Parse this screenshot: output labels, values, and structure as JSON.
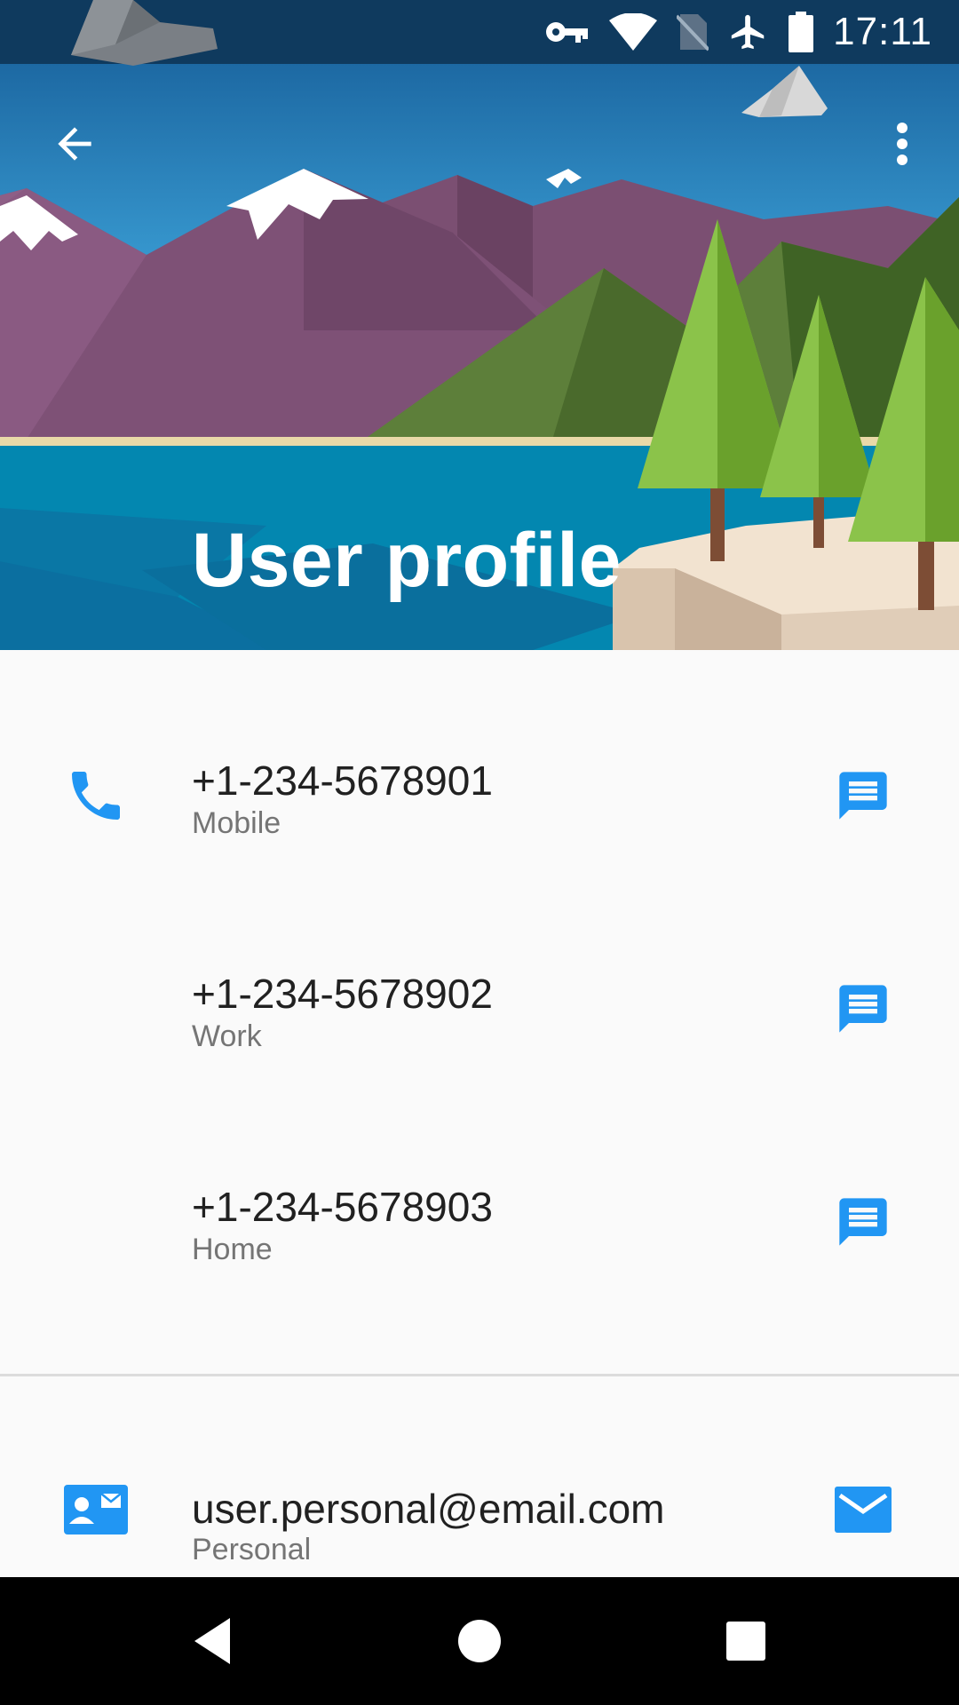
{
  "status_bar": {
    "time": "17:11",
    "icons": [
      "vpn-key-icon",
      "wifi-icon",
      "no-sim-icon",
      "airplane-mode-icon",
      "battery-icon"
    ]
  },
  "toolbar": {
    "title": "User profile",
    "back_icon": "arrow-back-icon",
    "menu_icon": "more-vert-icon"
  },
  "contacts": {
    "phones": [
      {
        "number": "+1-234-5678901",
        "type": "Mobile",
        "action_icon": "message-icon"
      },
      {
        "number": "+1-234-5678902",
        "type": "Work",
        "action_icon": "message-icon"
      },
      {
        "number": "+1-234-5678903",
        "type": "Home",
        "action_icon": "message-icon"
      }
    ],
    "phone_section_icon": "phone-icon",
    "emails": [
      {
        "address": "user.personal@email.com",
        "type": "Personal",
        "action_icon": "email-icon"
      }
    ],
    "email_section_icon": "contact-mail-icon"
  },
  "nav_bar": {
    "buttons": [
      "back-triangle-icon",
      "home-circle-icon",
      "recents-square-icon"
    ]
  },
  "colors": {
    "accent": "#2196f3",
    "status_bar": "#0f3a5e",
    "primary_text": "#212121",
    "secondary_text": "#757575"
  }
}
